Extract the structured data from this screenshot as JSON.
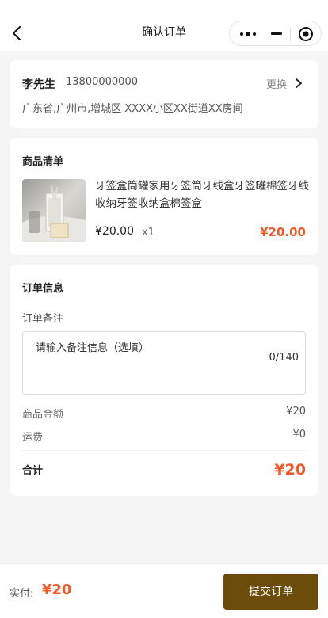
{
  "nav": {
    "title": "确认订单",
    "back_icon": "back-arrow-icon",
    "more_icon": "more-dots-icon",
    "minimize_icon": "minimize-icon",
    "close_icon": "target-close-icon"
  },
  "address": {
    "name": "李先生",
    "phone": "13800000000",
    "change_label": "更换",
    "detail": "广东省,广州市,增城区 XXXX小区XX街道XX房间"
  },
  "goods": {
    "section_title": "商品清单",
    "items": [
      {
        "name": "牙签盒筒罐家用牙签筒牙线盒牙签罐棉签牙线收纳牙签收纳盒棉签盒",
        "price": "¥20.00",
        "quantity": "x1",
        "subtotal": "¥20.00"
      }
    ]
  },
  "order_info": {
    "section_title": "订单信息",
    "remark_label": "订单备注",
    "remark_placeholder": "请输入备注信息（选填）",
    "remark_count": "0/140",
    "goods_amount_label": "商品金额",
    "goods_amount": "¥20",
    "shipping_label": "运费",
    "shipping": "¥0",
    "total_label": "合计",
    "total": "¥20"
  },
  "footer": {
    "pay_label": "实付:",
    "pay_amount": "¥20",
    "submit_label": "提交订单"
  },
  "colors": {
    "accent_price": "#f05a28",
    "submit_bg": "#6b4c0b",
    "page_bg": "#f5f5f5"
  }
}
